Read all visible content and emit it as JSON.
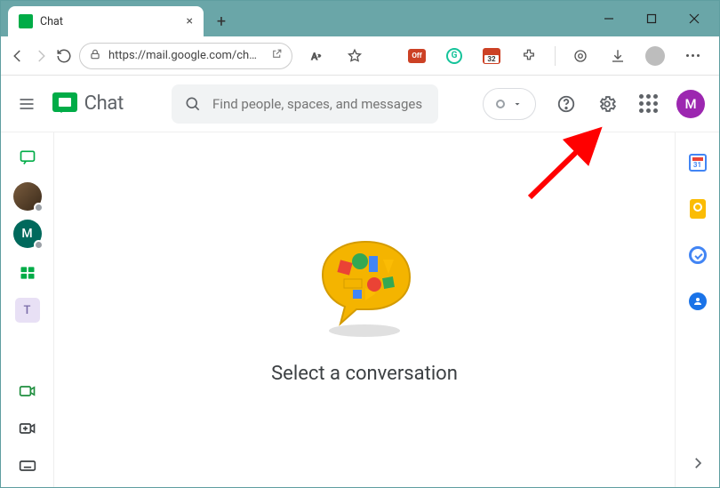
{
  "browser": {
    "tab_title": "Chat",
    "url_display": "https://mail.google.com/ch…",
    "calendar_badge": "32"
  },
  "header": {
    "product_name": "Chat",
    "search_placeholder": "Find people, spaces, and messages",
    "user_initial": "M"
  },
  "left_rail": {
    "user_m_initial": "M",
    "space_t_initial": "T"
  },
  "main": {
    "empty_state_text": "Select a conversation"
  },
  "right_rail": {
    "calendar_day": "31"
  },
  "annotation": {
    "target": "settings-gear"
  }
}
